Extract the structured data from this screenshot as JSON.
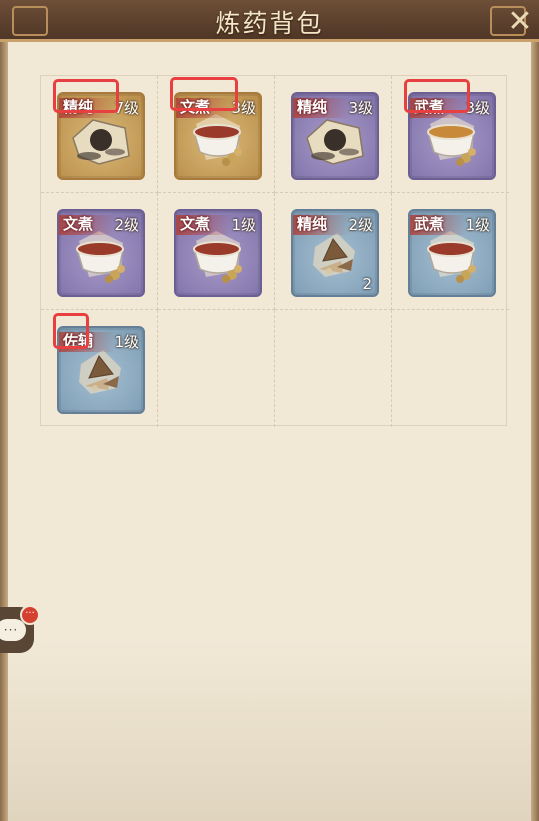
{
  "title": "炼药背包",
  "close_icon": "close-x-icon",
  "items": [
    {
      "type": "精纯",
      "level": "7级",
      "rarity": "gold",
      "art": "pill",
      "count": ""
    },
    {
      "type": "文煮",
      "level": "3级",
      "rarity": "gold",
      "art": "tea",
      "count": ""
    },
    {
      "type": "精纯",
      "level": "3级",
      "rarity": "purple",
      "art": "pill",
      "count": ""
    },
    {
      "type": "武煮",
      "level": "3级",
      "rarity": "purple",
      "art": "tea-light",
      "count": ""
    },
    {
      "type": "文煮",
      "level": "2级",
      "rarity": "purple",
      "art": "tea",
      "count": ""
    },
    {
      "type": "文煮",
      "level": "1级",
      "rarity": "purple",
      "art": "tea",
      "count": ""
    },
    {
      "type": "精纯",
      "level": "2级",
      "rarity": "blue",
      "art": "herb",
      "count": "2"
    },
    {
      "type": "武煮",
      "level": "1级",
      "rarity": "blue",
      "art": "tea",
      "count": ""
    },
    {
      "type": "佐辅",
      "level": "1级",
      "rarity": "blue",
      "art": "herb",
      "count": ""
    }
  ],
  "chat": {
    "bubble_text": "···",
    "badge_text": "···",
    "icon": "chat-bubble-icon"
  },
  "colors": {
    "highlight": "#e84040",
    "gold": "#c9a060",
    "purple": "#8e80b6",
    "blue": "#8aa8c0"
  }
}
